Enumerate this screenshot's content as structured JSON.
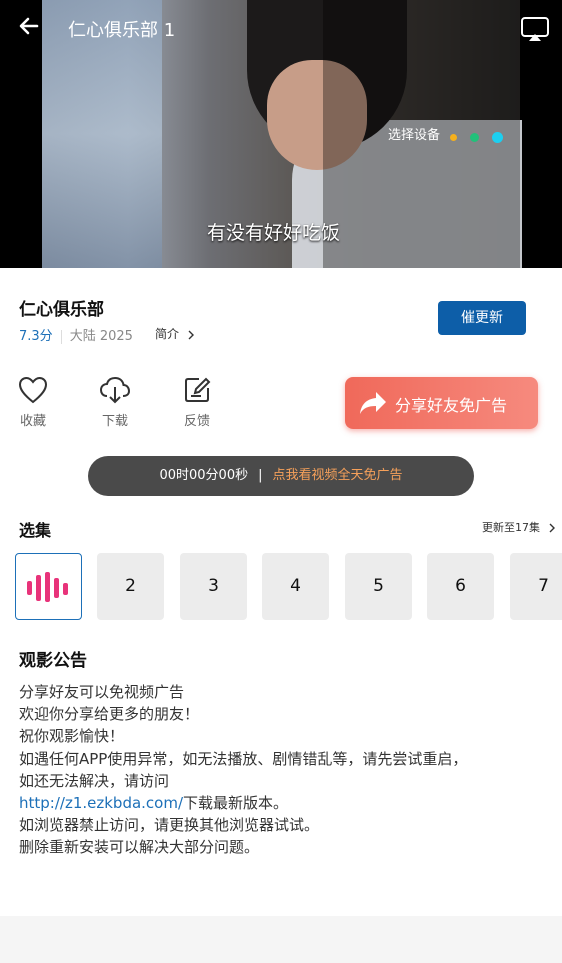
{
  "player": {
    "title": "仁心俱乐部 1",
    "device_label": "选择设备",
    "device_dots": [
      "#f5b01d",
      "#22c07a",
      "#1ccff0"
    ],
    "subtitle": "有没有好好吃饭"
  },
  "show": {
    "title": "仁心俱乐部",
    "rating": "7.3分",
    "region": "大陆",
    "year": "2025",
    "intro_label": "简介",
    "update_button": "催更新"
  },
  "actions": [
    {
      "label": "收藏",
      "icon": "heart-icon"
    },
    {
      "label": "下载",
      "icon": "download-icon"
    },
    {
      "label": "反馈",
      "icon": "edit-icon"
    }
  ],
  "share": {
    "label": "分享好友免广告",
    "icon": "share-arrow-icon",
    "color": "#f0695a"
  },
  "timer": {
    "time": "00时00分00秒",
    "separator": "|",
    "cta": "点我看视频全天免广告"
  },
  "episodes": {
    "title": "选集",
    "more": "更新至17集",
    "items": [
      "",
      "2",
      "3",
      "4",
      "5",
      "6",
      "7"
    ],
    "active_index": 0
  },
  "notice": {
    "title": "观影公告",
    "line1": "分享好友可以免视频广告",
    "line2": "欢迎你分享给更多的朋友！",
    "line3": "祝你观影愉快！",
    "line4": "如遇任何APP使用异常，如无法播放、剧情错乱等，请先尝试重启，",
    "line5": "如还无法解决，请访问",
    "link": "http://z1.ezkbda.com/",
    "line6_rest": "下载最新版本。",
    "line7": "如浏览器禁止访问，请更换其他浏览器试试。",
    "line8": "删除重新安装可以解决大部分问题。"
  },
  "colors": {
    "accent": "#1d70b8",
    "button_blue": "#0d5ea8",
    "orange": "#f5a05a"
  }
}
